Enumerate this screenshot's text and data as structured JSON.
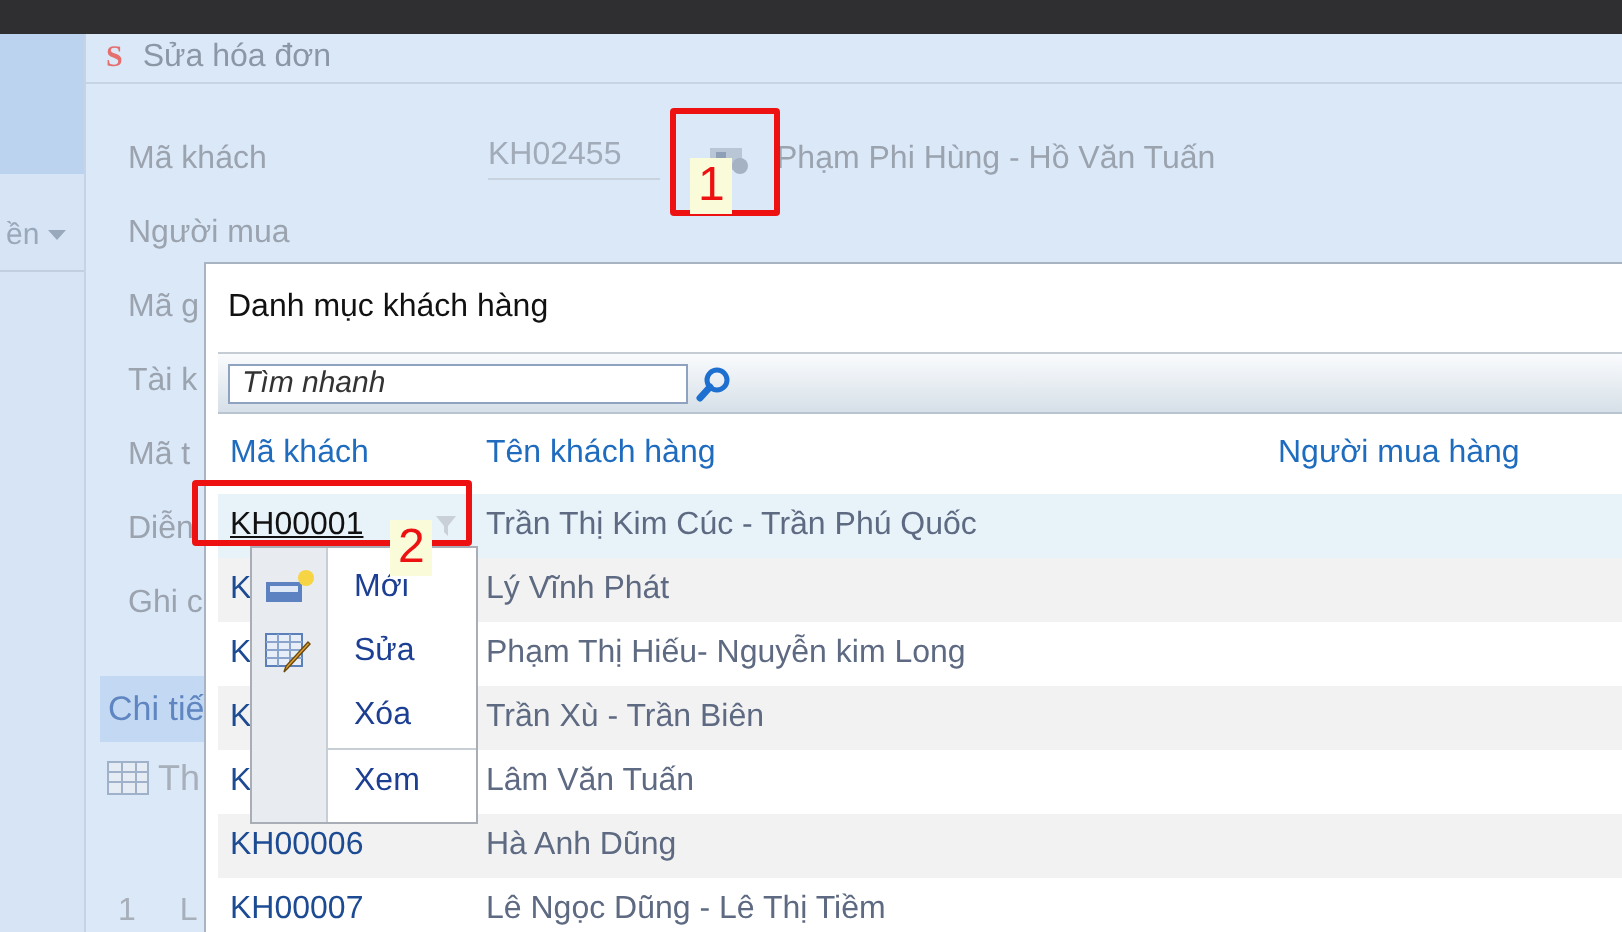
{
  "sidebar": {
    "item": "ền"
  },
  "form": {
    "logo": "S",
    "title": "Sửa hóa đơn",
    "fields": [
      {
        "label": "Mã khách",
        "value": "KH02455",
        "name": "Phạm Phi Hùng - Hồ Văn Tuấn"
      },
      {
        "label": "Người mua"
      },
      {
        "label": "Mã g"
      },
      {
        "label": "Tài k"
      },
      {
        "label": "Mã t"
      },
      {
        "label": "Diễn"
      },
      {
        "label": "Ghi c"
      }
    ],
    "detail_tab": "Chi tiế",
    "toolbar_label": "Th",
    "grid_row": {
      "number": "1",
      "cell": "L"
    }
  },
  "dialog": {
    "title": "Danh mục khách hàng",
    "search": {
      "placeholder": "Tìm nhanh"
    },
    "columns": [
      "Mã khách",
      "Tên khách hàng",
      "Người mua hàng"
    ],
    "rows": [
      {
        "code": "KH00001",
        "name": "Trần Thị Kim Cúc - Trần Phú Quốc",
        "selected": true
      },
      {
        "code": "K",
        "name": "Lý Vĩnh Phát",
        "selected": false
      },
      {
        "code": "K",
        "name": "Phạm Thị Hiếu- Nguyễn kim Long",
        "selected": false
      },
      {
        "code": "K",
        "name": "Trần Xù - Trần Biên",
        "selected": false
      },
      {
        "code": "K",
        "name": "Lâm Văn Tuấn",
        "selected": false
      },
      {
        "code": "KH00006",
        "name": "Hà Anh Dũng",
        "selected": false
      },
      {
        "code": "KH00007",
        "name": "Lê Ngọc Dũng - Lê Thị Tiềm",
        "selected": false
      }
    ]
  },
  "context_menu": {
    "items": [
      {
        "label": "Mới",
        "kind": "new",
        "separated": false
      },
      {
        "label": "Sửa",
        "kind": "edit",
        "separated": false
      },
      {
        "label": "Xóa",
        "kind": "plain",
        "separated": false
      },
      {
        "label": "Xem",
        "kind": "plain",
        "separated": true
      }
    ]
  },
  "annotations": [
    {
      "label": "1"
    },
    {
      "label": "2"
    }
  ]
}
